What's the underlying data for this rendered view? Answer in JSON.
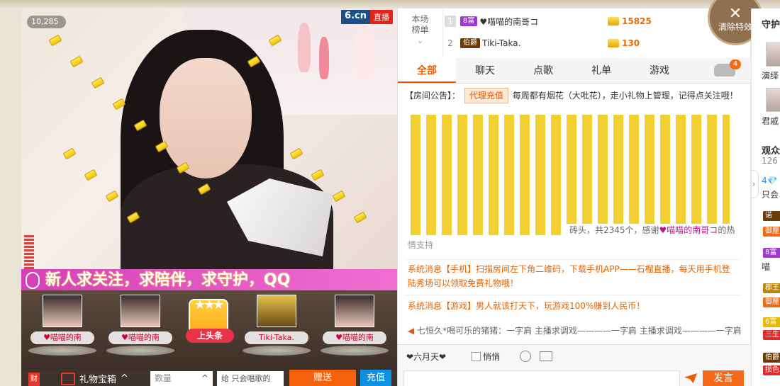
{
  "video": {
    "viewer_count": "10,285",
    "brand": "6.cn",
    "live_label": "直播",
    "marquee": "新人求关注，求陪伴，求守护，QQ"
  },
  "fans": [
    {
      "name": "♥喵喵的南"
    },
    {
      "name": "♥喵喵的南"
    },
    {
      "name": "Tiki-Taka."
    },
    {
      "name": "♥喵喵的南"
    }
  ],
  "headline_label": "上头条",
  "gift_bar": {
    "cai": "财",
    "gift_box": "礼物宝箱",
    "qty_placeholder": "数量",
    "recipient": "给 只会唱歌的",
    "send": "赠送",
    "recharge": "充值"
  },
  "ranking": {
    "tab_label": "本场\n榜单",
    "rows": [
      {
        "no": "1",
        "badge": "8富",
        "name": "♥喵喵的南哥コ",
        "amount": "15825",
        "badge_color": "#a037d4"
      },
      {
        "no": "2",
        "badge": "伯爵",
        "name": "Tiki-Taka.",
        "amount": "130",
        "badge_color": "#6c3b0a"
      }
    ]
  },
  "clear_effects": "清除特效",
  "tabs": [
    {
      "label": "全部",
      "active": true
    },
    {
      "label": "聊天",
      "active": false
    },
    {
      "label": "点歌",
      "active": false
    },
    {
      "label": "礼单",
      "active": false
    },
    {
      "label": "游戏",
      "active": false
    }
  ],
  "car_badge": "4",
  "notice": {
    "prefix": "【房间公告】：",
    "tag": "代理充值",
    "text": "每周都有烟花（大吡花），走小礼物上管理，记得点关注哦！"
  },
  "chat": {
    "brick_caption_prefix": "砖头，共2345个，感谢",
    "brick_caption_name": "♥喵喵的南哥コ",
    "brick_caption_suffix": "的热",
    "line1": "情支持",
    "sys1": "系统消息【手机】扫描房间左下角二维码，下载手机APP——石榴直播，每天用手机登陆秀场可以领取免费礼物哦！",
    "sys2": "系统消息【游戏】男人就该打天下，玩游戏100%赚到人民币！",
    "ticker": "七恒久*喝可乐的猪猪：一字肩 主播求调戏————一字肩 主播求调戏————一字肩"
  },
  "composer": {
    "target": "❤六月天❤",
    "private": "悄悄",
    "post": "发言"
  },
  "side": {
    "title": "守护",
    "user1": "演绎",
    "user2": "君戚",
    "viewers_label": "观众",
    "viewers_count": "126",
    "diamond": "4💎",
    "only": "只会",
    "b1": "诺",
    "b2": "御厘",
    "b3": "8富",
    "b4": "喵",
    "b5": "郡王",
    "b6": "御厘",
    "b7": "6富",
    "b8": "三生",
    "b9": "伯爵",
    "b10": "损色"
  }
}
